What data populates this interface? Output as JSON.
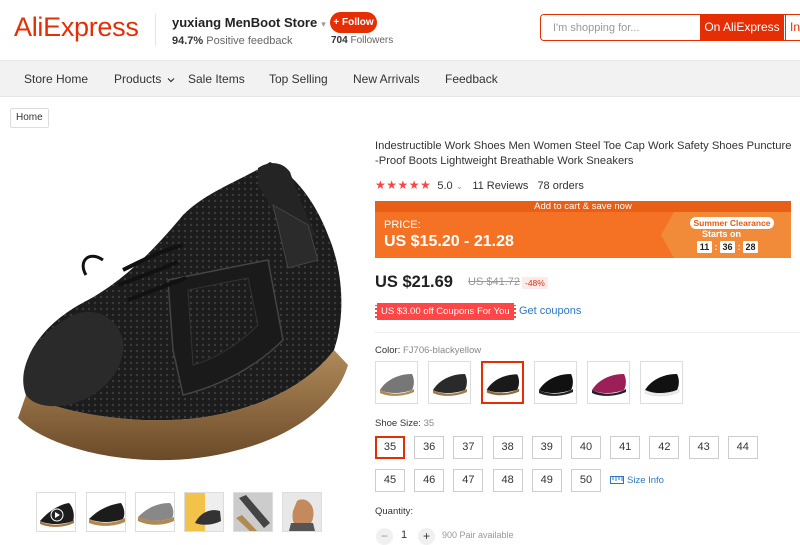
{
  "header": {
    "logo": "AliExpress",
    "store_name": "yuxiang MenBoot Store",
    "store_caret": "▾",
    "feedback_pct": "94.7%",
    "feedback_text": "Positive feedback",
    "follow_label": "+ Follow",
    "followers_count": "704",
    "followers_text": "Followers",
    "search_placeholder": "I'm shopping for...",
    "search_button": "On AliExpress",
    "search_button_2": "In"
  },
  "nav": {
    "items": [
      "Store Home",
      "Products",
      "Sale Items",
      "Top Selling",
      "New Arrivals",
      "Feedback"
    ]
  },
  "breadcrumb": "Home",
  "product": {
    "title": "Indestructible Work Shoes Men Women Steel Toe Cap Work Safety Shoes Puncture-Proof Boots Lightweight Breathable Work Sneakers",
    "stars": "★★★★★",
    "rating": "5.0",
    "rating_caret": "⌄",
    "reviews": "11 Reviews",
    "orders": "78 orders",
    "banner_top": "Add to cart & save now",
    "price_label": "PRICE:",
    "price_range": "US $15.20 - 21.28",
    "promo_label": "Summer Clearance",
    "starts_on": "Starts on",
    "countdown": [
      "11",
      "36",
      "28"
    ],
    "current_price": "US $21.69",
    "old_price": "US $41.72",
    "discount": "-48%",
    "coupon": "US $3.00 off Coupons For You",
    "get_coupons": "Get coupons",
    "color_label": "Color:",
    "color_value": "FJ706-blackyellow",
    "size_label": "Shoe Size:",
    "size_value": "35",
    "sizes": [
      "35",
      "36",
      "37",
      "38",
      "39",
      "40",
      "41",
      "42",
      "43",
      "44",
      "45",
      "46",
      "47",
      "48",
      "49",
      "50"
    ],
    "selected_size": "35",
    "size_info": "Size Info",
    "quantity_label": "Quantity:",
    "quantity": "1",
    "minus": "−",
    "plus": "+",
    "available": "900 Pair available"
  },
  "colors": {
    "brand": "#e62e04",
    "banner": "#f57224",
    "link": "#2e77c0"
  }
}
